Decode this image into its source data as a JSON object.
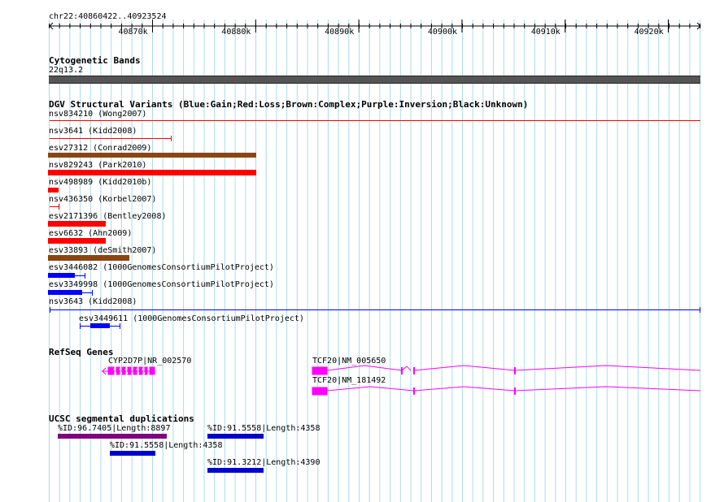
{
  "ruler": {
    "range_label": "chr22:40860422..40923524",
    "ticks": [
      "40870k",
      "40880k",
      "40890k",
      "40900k",
      "40910k",
      "40920k"
    ]
  },
  "cytoband": {
    "title": "Cytogenetic Bands",
    "band": "22q13.2"
  },
  "dgv": {
    "title": "DGV Structural Variants (Blue:Gain;Red:Loss;Brown:Complex;Purple:Inversion;Black:Unknown)",
    "items": [
      {
        "label": "nsv834210 (Wong2007)",
        "color": "#ff0000"
      },
      {
        "label": "nsv3641 (Kidd2008)",
        "color": "#ff0000"
      },
      {
        "label": "esv27312 (Conrad2009)",
        "color": "#8b4513"
      },
      {
        "label": "nsv829243 (Park2010)",
        "color": "#ff0000"
      },
      {
        "label": "nsv498989 (Kidd2010b)",
        "color": "#ff0000"
      },
      {
        "label": "nsv436350 (Korbel2007)",
        "color": "#ff0000"
      },
      {
        "label": "esv2171396 (Bentley2008)",
        "color": "#ff0000"
      },
      {
        "label": "esv6632 (Ahn2009)",
        "color": "#ff0000"
      },
      {
        "label": "esv33893 (deSmith2007)",
        "color": "#8b4513"
      },
      {
        "label": "esv3446082 (1000GenomesConsortiumPilotProject)",
        "color": "#0000ff"
      },
      {
        "label": "esv3349998 (1000GenomesConsortiumPilotProject)",
        "color": "#0000ff"
      },
      {
        "label": "nsv3643 (Kidd2008)",
        "color": "#0000ff"
      },
      {
        "label": "esv3449611 (1000GenomesConsortiumPilotProject)",
        "color": "#0000ff"
      }
    ]
  },
  "refseq": {
    "title": "RefSeq Genes",
    "genes": [
      {
        "label": "CYP2D7P|NR_002570",
        "color": "#ff00ff"
      },
      {
        "label": "TCF20|NM_005650",
        "color": "#ff00ff"
      },
      {
        "label": "TCF20|NM_181492",
        "color": "#ff00ff"
      }
    ]
  },
  "segdup": {
    "title": "UCSC segmental duplications",
    "items": [
      {
        "label": "%ID:96.7405|Length:8897",
        "color": "#800080"
      },
      {
        "label": "%ID:91.5558|Length:4358",
        "color": "#0000cc"
      },
      {
        "label": "%ID:91.5558|Length:4358",
        "color": "#0000cc"
      },
      {
        "label": "%ID:91.3212|Length:4390",
        "color": "#0000cc"
      }
    ]
  },
  "colors": {
    "grid": "#a8dde8",
    "loss": "#ff0000",
    "gain": "#0000ff",
    "complex": "#8b4513",
    "gene": "#ff00ff"
  }
}
